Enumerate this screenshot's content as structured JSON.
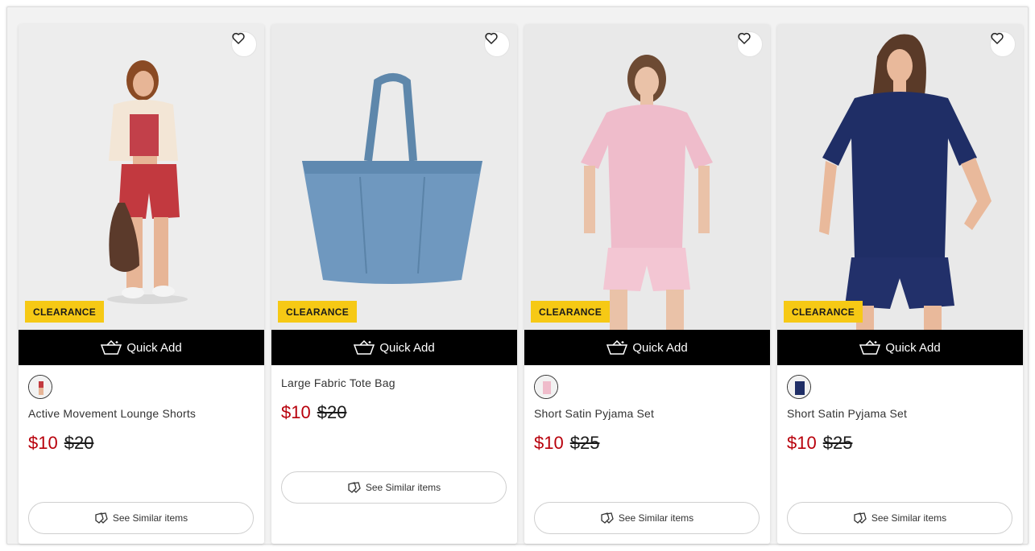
{
  "products": [
    {
      "badge": "CLEARANCE",
      "quick_add": "Quick Add",
      "title": "Active Movement Lounge Shorts",
      "price_now": "$10",
      "price_was": "$20",
      "similar": "See Similar items",
      "has_swatch": true
    },
    {
      "badge": "CLEARANCE",
      "quick_add": "Quick Add",
      "title": "Large Fabric Tote Bag",
      "price_now": "$10",
      "price_was": "$20",
      "similar": "See Similar items",
      "has_swatch": false
    },
    {
      "badge": "CLEARANCE",
      "quick_add": "Quick Add",
      "title": "Short Satin Pyjama Set",
      "price_now": "$10",
      "price_was": "$25",
      "similar": "See Similar items",
      "has_swatch": true
    },
    {
      "badge": "CLEARANCE",
      "quick_add": "Quick Add",
      "title": "Short Satin Pyjama Set",
      "price_now": "$10",
      "price_was": "$25",
      "similar": "See Similar items",
      "has_swatch": true
    }
  ],
  "colors": {
    "badge": "#f6c915",
    "sale_price": "#b8000b",
    "quick_add_bg": "#000000"
  },
  "icons": {
    "wishlist": "heart-icon",
    "quick_add": "basket-icon",
    "similar": "similar-items-icon"
  }
}
